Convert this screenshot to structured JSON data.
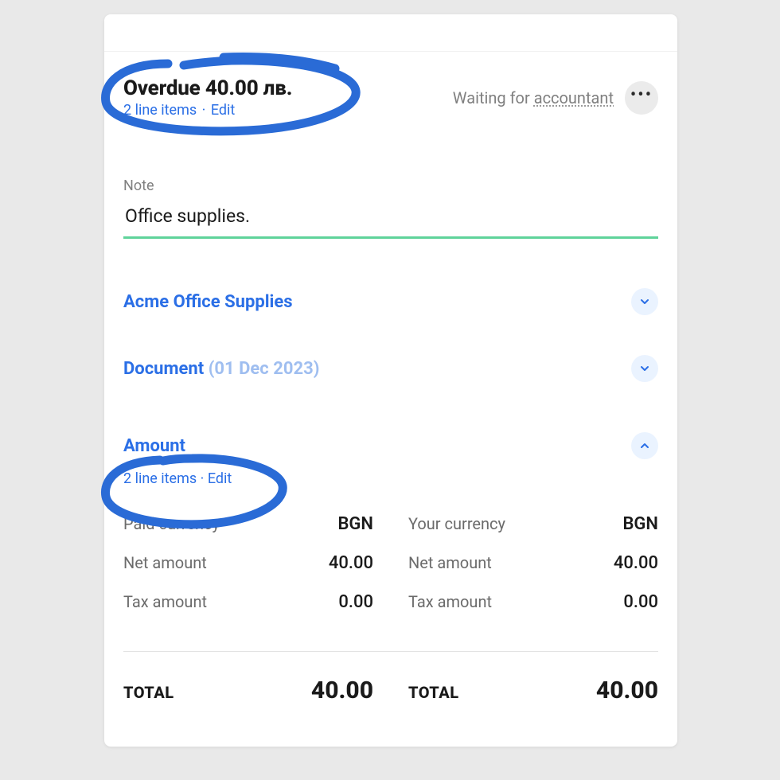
{
  "header": {
    "overdue_line": "Overdue 40.00 лв.",
    "line_items_text": "2 line items",
    "edit_text": "Edit",
    "waiting_prefix": "Waiting for ",
    "waiting_role": "accountant"
  },
  "note": {
    "label": "Note",
    "value": "Office supplies."
  },
  "sections": {
    "supplier": {
      "title": "Acme Office Supplies"
    },
    "document": {
      "title": "Document",
      "date": "(01 Dec 2023)"
    },
    "amount": {
      "title": "Amount",
      "line_items_text": "2 line items",
      "edit_text": "Edit",
      "left": {
        "currency_label": "Paid currency",
        "currency_value": "BGN",
        "net_label": "Net amount",
        "net_value": "40.00",
        "tax_label": "Tax amount",
        "tax_value": "0.00",
        "total_label": "TOTAL",
        "total_value": "40.00"
      },
      "right": {
        "currency_label": "Your currency",
        "currency_value": "BGN",
        "net_label": "Net amount",
        "net_value": "40.00",
        "tax_label": "Tax amount",
        "tax_value": "0.00",
        "total_label": "TOTAL",
        "total_value": "40.00"
      }
    }
  }
}
